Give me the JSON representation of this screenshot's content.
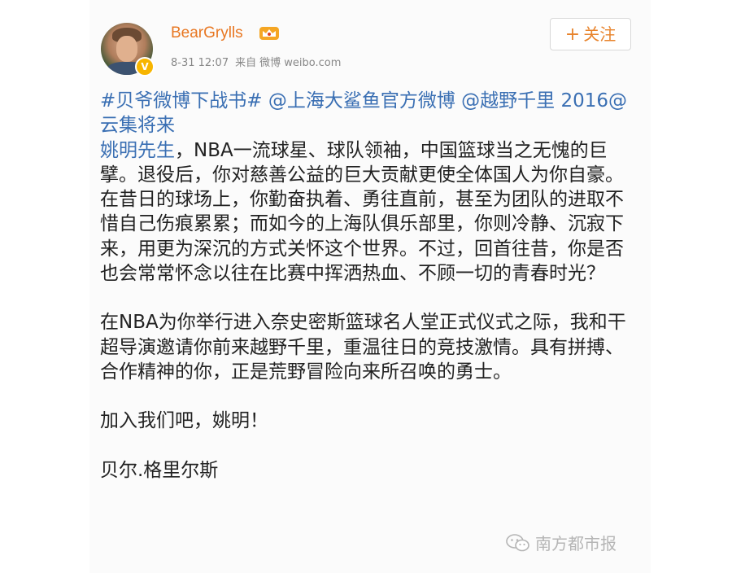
{
  "user": {
    "name": "BearGrylls",
    "verified_badge": "V"
  },
  "meta": {
    "date": "8-31 12:07",
    "source_label": "来自",
    "source": "微博 weibo.com"
  },
  "follow_button": {
    "icon": "+",
    "label": "关注"
  },
  "post": {
    "hashtag": "#贝爷微博下战书#",
    "mention1": "@上海大鲨鱼官方微博",
    "mention2": "@越野千里",
    "tag_text": "2016@云集将来",
    "mention3": "姚明先生",
    "para1": "，NBA一流球星、球队领袖，中国篮球当之无愧的巨擘。退役后，你对慈善公益的巨大贡献更使全体国人为你自豪。在昔日的球场上，你勤奋执着、勇往直前，甚至为团队的进取不惜自己伤痕累累；而如今的上海队俱乐部里，你则冷静、沉寂下来，用更为深沉的方式关怀这个世界。不过，回首往昔，你是否也会常常怀念以往在比赛中挥洒热血、不顾一切的青春时光？",
    "para2": "在NBA为你举行进入奈史密斯篮球名人堂正式仪式之际，我和干超导演邀请你前来越野千里，重温往日的竞技激情。具有拼搏、合作精神的你，正是荒野冒险向来所召唤的勇士。",
    "para3": "加入我们吧，姚明！",
    "signature": "贝尔.格里尔斯"
  },
  "watermark": {
    "text": "南方都市报"
  },
  "colors": {
    "username": "#e87722",
    "link": "#3a6fb3",
    "follow": "#e8832b",
    "text": "#222222",
    "meta": "#888888"
  }
}
